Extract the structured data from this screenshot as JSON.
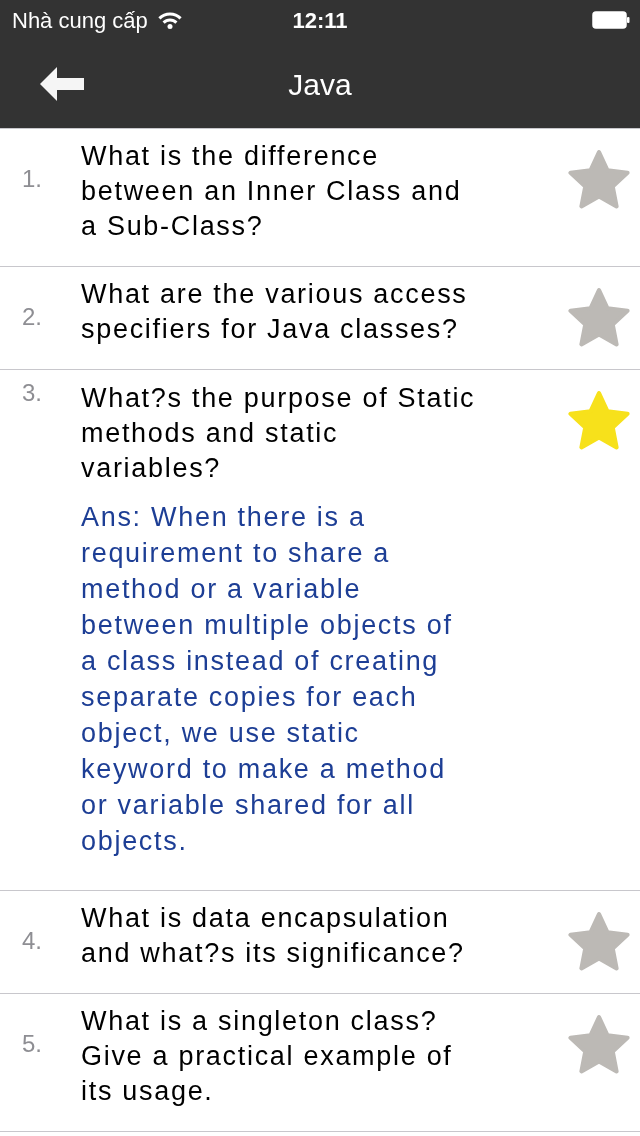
{
  "status_bar": {
    "carrier": "Nhà cung cấp",
    "time": "12:11"
  },
  "nav_bar": {
    "title": "Java"
  },
  "questions": [
    {
      "number": "1.",
      "text": "What is the difference between an Inner Class and a Sub-Class?",
      "starred": false
    },
    {
      "number": "2.",
      "text": "What are the various access specifiers for Java classes?",
      "starred": false
    },
    {
      "number": "3.",
      "text": "What?s the purpose of Static methods and static variables?",
      "starred": true,
      "answer": "Ans: When there is a requirement to share a method or a variable between multiple objects of a class instead of creating separate copies for each object, we use static keyword to make a method or variable shared for all objects."
    },
    {
      "number": "4.",
      "text": "What is data encapsulation and what?s its significance?",
      "starred": false
    },
    {
      "number": "5.",
      "text": "What is a singleton class? Give a practical example of its usage.",
      "starred": false
    }
  ]
}
